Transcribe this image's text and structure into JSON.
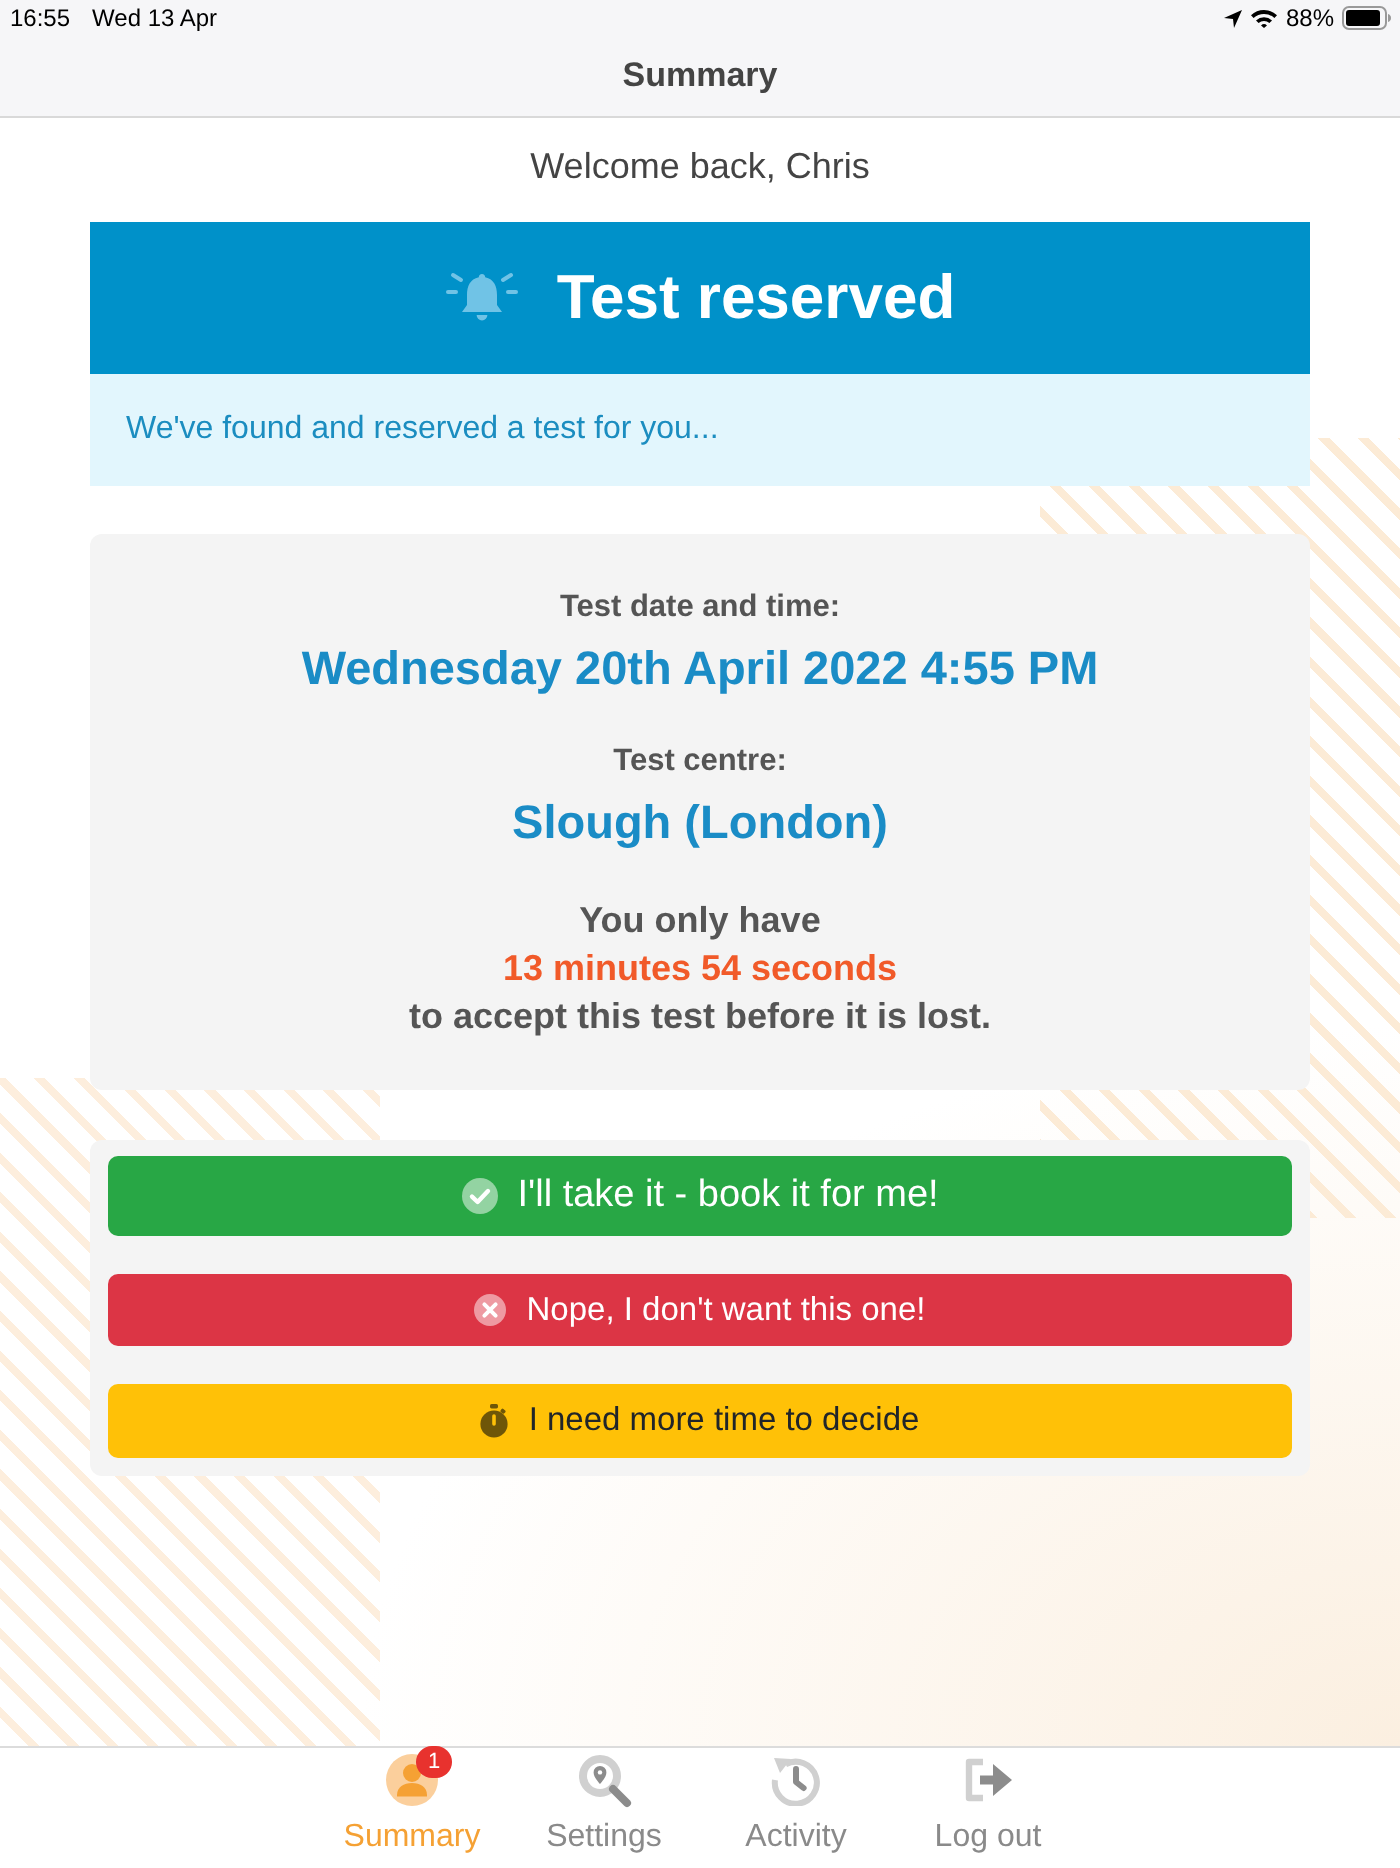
{
  "status_bar": {
    "time": "16:55",
    "date": "Wed 13 Apr",
    "battery": "88%"
  },
  "nav_bar": {
    "title": "Summary"
  },
  "welcome": "Welcome back, Chris",
  "alert": {
    "title": "Test reserved",
    "message": "We've found and reserved a test for you..."
  },
  "details": [
    {
      "label": "Test date and time:",
      "value": "Wednesday 20th April 2022 4:55 PM"
    },
    {
      "label": "Test centre:",
      "value": "Slough (London)"
    }
  ],
  "countdown": {
    "lead": "You only have",
    "remaining": "13 minutes 54 seconds",
    "tail": "to accept this test before it is lost."
  },
  "actions": [
    {
      "kind": "accept",
      "label": "I'll take it - book it for me!"
    },
    {
      "kind": "decline",
      "label": "Nope, I don't want this one!"
    },
    {
      "kind": "defer",
      "label": "I need more time to decide"
    }
  ],
  "tab_bar": {
    "tabs": [
      {
        "kind": "summary",
        "label": "Summary",
        "selected": true,
        "badge": "1"
      },
      {
        "kind": "settings",
        "label": "Settings",
        "selected": false
      },
      {
        "kind": "activity",
        "label": "Activity",
        "selected": false
      },
      {
        "kind": "logout",
        "label": "Log out",
        "selected": false
      }
    ]
  }
}
